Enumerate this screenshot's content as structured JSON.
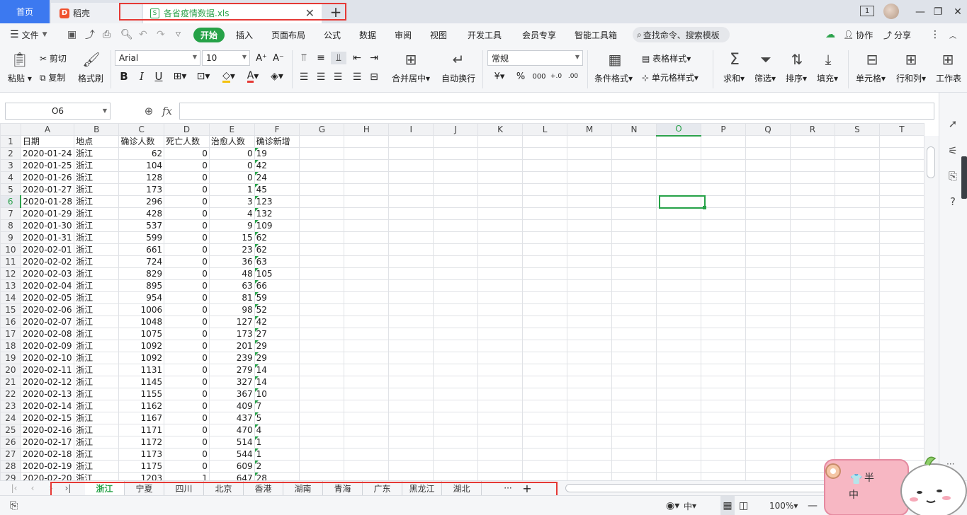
{
  "titlebar": {
    "home_tab": "首页",
    "daoke_tab": "稻壳",
    "file_tab": "各省疫情数据.xls",
    "file_icon_letter": "S",
    "window_badge": "1"
  },
  "menu": {
    "file": "文件",
    "items": [
      "开始",
      "插入",
      "页面布局",
      "公式",
      "数据",
      "审阅",
      "视图",
      "开发工具",
      "会员专享",
      "智能工具箱"
    ],
    "search_placeholder": "查找命令、搜索模板",
    "collab": "协作",
    "share": "分享"
  },
  "ribbon": {
    "paste": "粘贴",
    "cut": "剪切",
    "copy": "复制",
    "format_painter": "格式刷",
    "font_name": "Arial",
    "font_size": "10",
    "merge_center": "合并居中",
    "auto_wrap": "自动换行",
    "number_format": "常规",
    "table_style": "表格样式",
    "conditional_format": "条件格式",
    "cell_style": "单元格样式",
    "sum": "求和",
    "filter": "筛选",
    "sort": "排序",
    "fill": "填充",
    "cells": "单元格",
    "row_col": "行和列",
    "worksheet": "工作表"
  },
  "formula_bar": {
    "name_box": "O6",
    "fx": "fx",
    "content": ""
  },
  "grid": {
    "columns": [
      "A",
      "B",
      "C",
      "D",
      "E",
      "F",
      "G",
      "H",
      "I",
      "J",
      "K",
      "L",
      "M",
      "N",
      "O",
      "P",
      "Q",
      "R",
      "S",
      "T"
    ],
    "header_row": [
      "日期",
      "地点",
      "确诊人数",
      "死亡人数",
      "治愈人数",
      "确诊新增"
    ],
    "rows": [
      [
        "2020-01-24",
        "浙江",
        "62",
        "0",
        "0",
        "19"
      ],
      [
        "2020-01-25",
        "浙江",
        "104",
        "0",
        "0",
        "42"
      ],
      [
        "2020-01-26",
        "浙江",
        "128",
        "0",
        "0",
        "24"
      ],
      [
        "2020-01-27",
        "浙江",
        "173",
        "0",
        "1",
        "45"
      ],
      [
        "2020-01-28",
        "浙江",
        "296",
        "0",
        "3",
        "123"
      ],
      [
        "2020-01-29",
        "浙江",
        "428",
        "0",
        "4",
        "132"
      ],
      [
        "2020-01-30",
        "浙江",
        "537",
        "0",
        "9",
        "109"
      ],
      [
        "2020-01-31",
        "浙江",
        "599",
        "0",
        "15",
        "62"
      ],
      [
        "2020-02-01",
        "浙江",
        "661",
        "0",
        "23",
        "62"
      ],
      [
        "2020-02-02",
        "浙江",
        "724",
        "0",
        "36",
        "63"
      ],
      [
        "2020-02-03",
        "浙江",
        "829",
        "0",
        "48",
        "105"
      ],
      [
        "2020-02-04",
        "浙江",
        "895",
        "0",
        "63",
        "66"
      ],
      [
        "2020-02-05",
        "浙江",
        "954",
        "0",
        "81",
        "59"
      ],
      [
        "2020-02-06",
        "浙江",
        "1006",
        "0",
        "98",
        "52"
      ],
      [
        "2020-02-07",
        "浙江",
        "1048",
        "0",
        "127",
        "42"
      ],
      [
        "2020-02-08",
        "浙江",
        "1075",
        "0",
        "173",
        "27"
      ],
      [
        "2020-02-09",
        "浙江",
        "1092",
        "0",
        "201",
        "29"
      ],
      [
        "2020-02-10",
        "浙江",
        "1092",
        "0",
        "239",
        "29"
      ],
      [
        "2020-02-11",
        "浙江",
        "1131",
        "0",
        "279",
        "14"
      ],
      [
        "2020-02-12",
        "浙江",
        "1145",
        "0",
        "327",
        "14"
      ],
      [
        "2020-02-13",
        "浙江",
        "1155",
        "0",
        "367",
        "10"
      ],
      [
        "2020-02-14",
        "浙江",
        "1162",
        "0",
        "409",
        "7"
      ],
      [
        "2020-02-15",
        "浙江",
        "1167",
        "0",
        "437",
        "5"
      ],
      [
        "2020-02-16",
        "浙江",
        "1171",
        "0",
        "470",
        "4"
      ],
      [
        "2020-02-17",
        "浙江",
        "1172",
        "0",
        "514",
        "1"
      ],
      [
        "2020-02-18",
        "浙江",
        "1173",
        "0",
        "544",
        "1"
      ],
      [
        "2020-02-19",
        "浙江",
        "1175",
        "0",
        "609",
        "2"
      ],
      [
        "2020-02-20",
        "浙江",
        "1203",
        "1",
        "647",
        "28"
      ]
    ],
    "selected_column": "O",
    "selected_row": "6"
  },
  "sheet_tabs": [
    "浙江",
    "宁夏",
    "四川",
    "北京",
    "香港",
    "湖南",
    "青海",
    "广东",
    "黑龙江",
    "湖北"
  ],
  "sheet_more": "···",
  "sheet_add": "+",
  "status": {
    "zoom": "100%",
    "ime": "中"
  },
  "sticker": {
    "text_top": "半",
    "text_bottom": "中"
  },
  "colors": {
    "accent_green": "#26a248",
    "home_tab_blue": "#3c79f0",
    "highlight_red": "#e53935"
  }
}
